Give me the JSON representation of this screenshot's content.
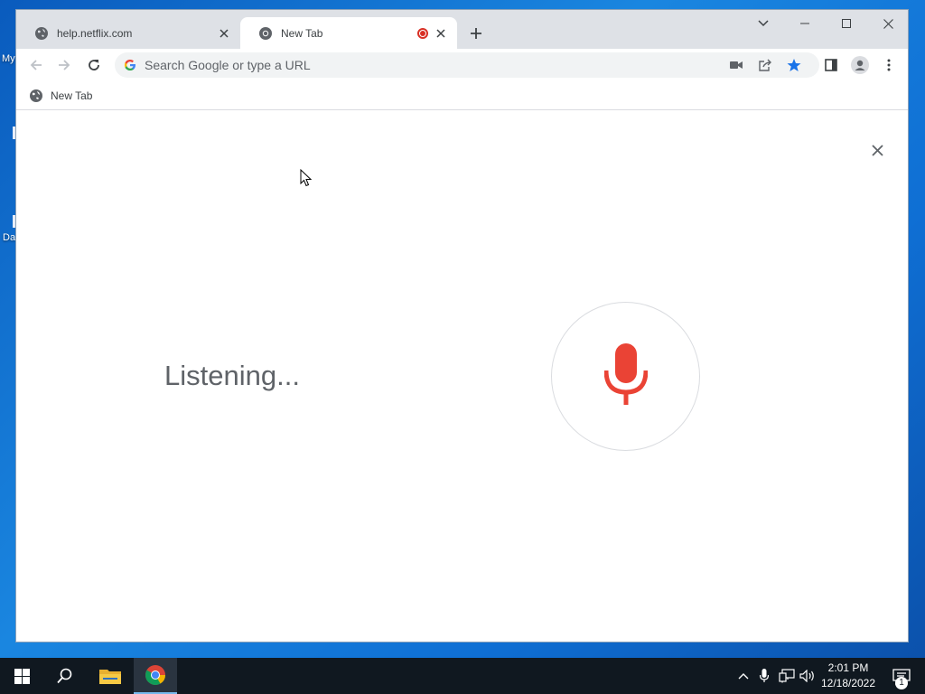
{
  "desktop": {
    "icon_labels": [
      "My",
      "Da"
    ]
  },
  "browser": {
    "tabs": [
      {
        "title": "help.netflix.com",
        "active": false,
        "favicon": "globe-icon"
      },
      {
        "title": "New Tab",
        "active": true,
        "favicon": "chrome-icon",
        "recording": true
      }
    ],
    "omnibox": {
      "placeholder": "Search Google or type a URL",
      "value": ""
    },
    "bookmarks": [
      {
        "label": "New Tab",
        "favicon": "globe-icon"
      }
    ],
    "voice_search": {
      "status_text": "Listening..."
    },
    "colors": {
      "mic_red": "#ea4335",
      "bookmark_star_blue": "#1a73e8",
      "recording_red": "#d93025"
    }
  },
  "taskbar": {
    "clock": {
      "time": "2:01 PM",
      "date": "12/18/2022"
    },
    "notification_count": "1"
  }
}
